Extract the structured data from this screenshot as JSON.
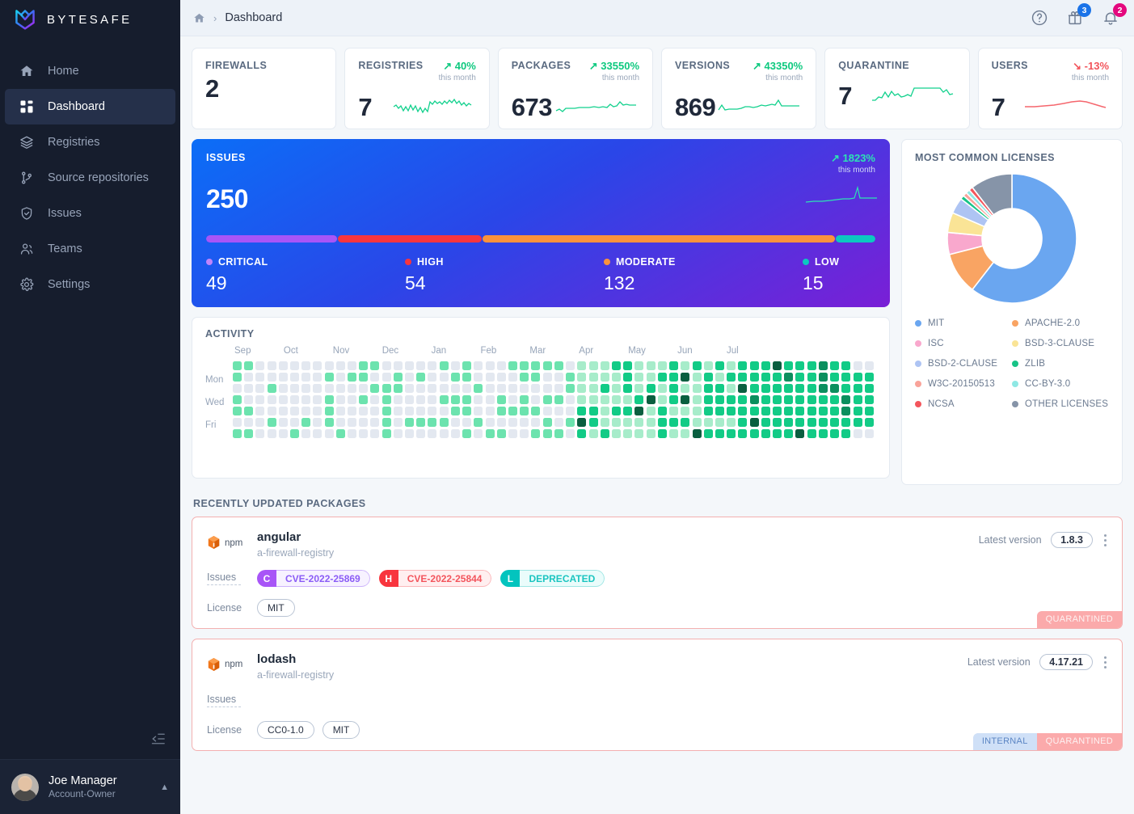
{
  "sidebar": {
    "brand": "BYTESAFE",
    "items": [
      {
        "label": "Home",
        "icon": "home-icon",
        "active": false
      },
      {
        "label": "Dashboard",
        "icon": "grid-icon",
        "active": true
      },
      {
        "label": "Registries",
        "icon": "layers-icon",
        "active": false
      },
      {
        "label": "Source repositories",
        "icon": "branch-icon",
        "active": false
      },
      {
        "label": "Issues",
        "icon": "shield-check-icon",
        "active": false
      },
      {
        "label": "Teams",
        "icon": "users-icon",
        "active": false
      },
      {
        "label": "Settings",
        "icon": "gear-icon",
        "active": false
      }
    ],
    "user": {
      "name": "Joe Manager",
      "role": "Account-Owner"
    }
  },
  "topbar": {
    "breadcrumb_home": "home-icon",
    "breadcrumb_sep": "›",
    "breadcrumb_current": "Dashboard",
    "help_icon": "question-circle-icon",
    "gift_icon": "gift-icon",
    "gift_badge": "3",
    "bell_icon": "bell-icon",
    "bell_badge": "2"
  },
  "stats": [
    {
      "label": "FIREWALLS",
      "value": "2",
      "trend": null,
      "trend_dir": null,
      "trend_sub": null,
      "spark": null
    },
    {
      "label": "REGISTRIES",
      "value": "7",
      "trend": "40%",
      "trend_dir": "up",
      "trend_sub": "this month",
      "spark": "green"
    },
    {
      "label": "PACKAGES",
      "value": "673",
      "trend": "33550%",
      "trend_dir": "up",
      "trend_sub": "this month",
      "spark": "green"
    },
    {
      "label": "VERSIONS",
      "value": "869",
      "trend": "43350%",
      "trend_dir": "up",
      "trend_sub": "this month",
      "spark": "green"
    },
    {
      "label": "QUARANTINE",
      "value": "7",
      "trend": null,
      "trend_dir": null,
      "trend_sub": null,
      "spark": "green"
    },
    {
      "label": "USERS",
      "value": "7",
      "trend": "-13%",
      "trend_dir": "down",
      "trend_sub": "this month",
      "spark": "red"
    }
  ],
  "issues": {
    "label": "ISSUES",
    "total": "250",
    "trend": "1823%",
    "trend_sub": "this month",
    "severities": [
      {
        "name": "CRITICAL",
        "value": "49",
        "color": "#a855f7",
        "pct": 19.6
      },
      {
        "name": "HIGH",
        "value": "54",
        "color": "#f8353e",
        "pct": 21.6
      },
      {
        "name": "MODERATE",
        "value": "132",
        "color": "#fb923c",
        "pct": 52.8
      },
      {
        "name": "LOW",
        "value": "15",
        "color": "#0cc8c0",
        "pct": 6.0
      }
    ]
  },
  "activity": {
    "title": "ACTIVITY",
    "months": [
      "Sep",
      "Oct",
      "Nov",
      "Dec",
      "Jan",
      "Feb",
      "Mar",
      "Apr",
      "May",
      "Jun",
      "Jul"
    ],
    "day_labels": [
      "",
      "Mon",
      "",
      "Wed",
      "",
      "Fri",
      ""
    ],
    "weeks": 56,
    "levels_legend": [
      "#e3e8f0",
      "#a7ecca",
      "#6ce3ae",
      "#12cb86",
      "#0b8f5e",
      "#0a5f40"
    ]
  },
  "licenses": {
    "title": "MOST COMMON LICENSES",
    "items": [
      {
        "name": "MIT",
        "color": "#6aa6f0"
      },
      {
        "name": "APACHE-2.0",
        "color": "#f9a463"
      },
      {
        "name": "ISC",
        "color": "#f9a8cd"
      },
      {
        "name": "BSD-3-CLAUSE",
        "color": "#fae496"
      },
      {
        "name": "BSD-2-CLAUSE",
        "color": "#aec4f3"
      },
      {
        "name": "ZLIB",
        "color": "#18c387"
      },
      {
        "name": "W3C-20150513",
        "color": "#f9a39a"
      },
      {
        "name": "CC-BY-3.0",
        "color": "#8fe8e4"
      },
      {
        "name": "NCSA",
        "color": "#f3555c"
      },
      {
        "name": "OTHER LICENSES",
        "color": "#8694a8"
      }
    ]
  },
  "chart_data": {
    "type": "pie",
    "title": "MOST COMMON LICENSES",
    "labels": [
      "MIT",
      "APACHE-2.0",
      "ISC",
      "BSD-3-CLAUSE",
      "BSD-2-CLAUSE",
      "ZLIB",
      "W3C-20150513",
      "CC-BY-3.0",
      "NCSA",
      "OTHER LICENSES"
    ],
    "values": [
      60.5,
      10.5,
      5.5,
      5.0,
      4.0,
      1.0,
      1.0,
      1.0,
      1.0,
      10.5
    ],
    "colors": [
      "#6aa6f0",
      "#f9a463",
      "#f9a8cd",
      "#fae496",
      "#aec4f3",
      "#18c387",
      "#f9a39a",
      "#8fe8e4",
      "#f3555c",
      "#8694a8"
    ],
    "legend": "bottom",
    "donut_hole": 0.46
  },
  "packages": {
    "title": "RECENTLY UPDATED PACKAGES",
    "items": [
      {
        "registry_type": "npm",
        "name": "angular",
        "registry": "a-firewall-registry",
        "latest_label": "Latest version",
        "version": "1.8.3",
        "issues_label": "Issues",
        "issues": [
          {
            "letter": "C",
            "text": "CVE-2022-25869",
            "bg": "#a855f7",
            "text_color": "#8b5cf6",
            "pill_bg": "#f6f0ff",
            "border": "#cdb4fb"
          },
          {
            "letter": "H",
            "text": "CVE-2022-25844",
            "bg": "#f8353e",
            "text_color": "#f3545c",
            "pill_bg": "#ffeeee",
            "border": "#fbb7ba"
          },
          {
            "letter": "L",
            "text": "DEPRECATED",
            "bg": "#03c4be",
            "text_color": "#1bc5c0",
            "pill_bg": "#eafcfb",
            "border": "#9fe6e4"
          }
        ],
        "license_label": "License",
        "licenses": [
          "MIT"
        ],
        "tags": [
          "QUARANTINED"
        ]
      },
      {
        "registry_type": "npm",
        "name": "lodash",
        "registry": "a-firewall-registry",
        "latest_label": "Latest version",
        "version": "4.17.21",
        "issues_label": "Issues",
        "issues": [],
        "license_label": "License",
        "licenses": [
          "CC0-1.0",
          "MIT"
        ],
        "tags": [
          "INTERNAL",
          "QUARANTINED"
        ]
      }
    ]
  },
  "colors": {
    "sidebar_bg": "#161d2d",
    "accent_green": "#0ec97f",
    "accent_red": "#f2545b",
    "page_bg": "#f4f7fa"
  }
}
